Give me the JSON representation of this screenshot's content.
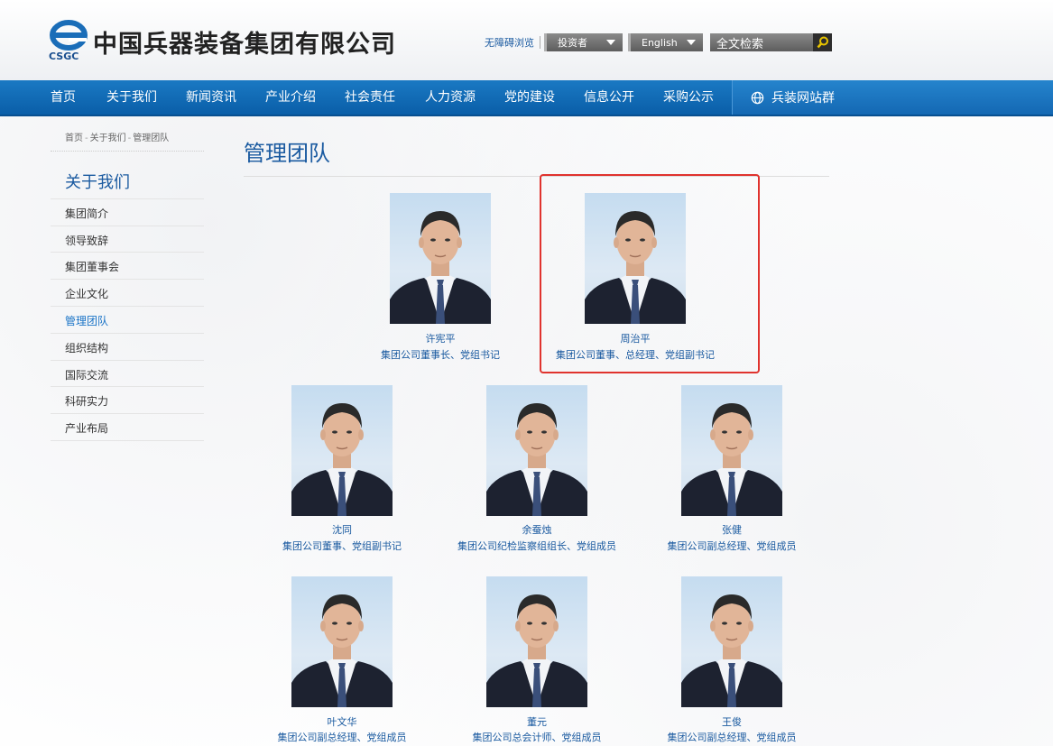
{
  "header": {
    "logo_text": "中国兵器装备集团有限公司",
    "logo_abbr": "CSGC",
    "accessibility_label": "无障碍浏览",
    "investor_label": "投资者",
    "language_label": "English",
    "search_placeholder": "全文检索"
  },
  "nav": {
    "items": [
      "首页",
      "关于我们",
      "新闻资讯",
      "产业介绍",
      "社会责任",
      "人力资源",
      "党的建设",
      "信息公开",
      "采购公示"
    ],
    "site_group": "兵装网站群"
  },
  "breadcrumb": [
    "首页",
    "关于我们",
    "管理团队"
  ],
  "sidebar": {
    "title": "关于我们",
    "items": [
      "集团简介",
      "领导致辞",
      "集团董事会",
      "企业文化",
      "管理团队",
      "组织结构",
      "国际交流",
      "科研实力",
      "产业布局"
    ],
    "active": "管理团队"
  },
  "main": {
    "title": "管理团队",
    "people": [
      {
        "name": "许宪平",
        "title": "集团公司董事长、党组书记"
      },
      {
        "name": "周治平",
        "title": "集团公司董事、总经理、党组副书记"
      },
      {
        "name": "沈同",
        "title": "集团公司董事、党组副书记"
      },
      {
        "name": "余蚕烛",
        "title": "集团公司纪检监察组组长、党组成员"
      },
      {
        "name": "张健",
        "title": "集团公司副总经理、党组成员"
      },
      {
        "name": "叶文华",
        "title": "集团公司副总经理、党组成员"
      },
      {
        "name": "董元",
        "title": "集团公司总会计师、党组成员"
      },
      {
        "name": "王俊",
        "title": "集团公司副总经理、党组成员"
      }
    ]
  },
  "colors": {
    "nav_blue": "#0a5ea8",
    "link_blue": "#1a5aa0",
    "highlight_red": "#e0332e"
  }
}
